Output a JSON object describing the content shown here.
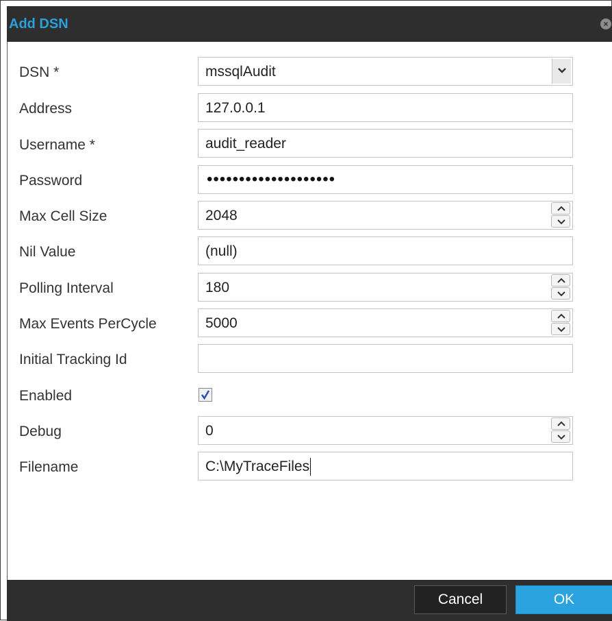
{
  "dialog": {
    "title": "Add DSN",
    "close_icon": "close-icon"
  },
  "fields": {
    "dsn": {
      "label": "DSN *",
      "value": "mssqlAudit"
    },
    "address": {
      "label": "Address",
      "value": "127.0.0.1"
    },
    "username": {
      "label": "Username *",
      "value": "audit_reader"
    },
    "password": {
      "label": "Password",
      "value": "••••••••••••••••••••"
    },
    "max_cell_size": {
      "label": "Max Cell Size",
      "value": "2048"
    },
    "nil_value": {
      "label": "Nil Value",
      "value": "(null)"
    },
    "polling_interval": {
      "label": "Polling Interval",
      "value": "180"
    },
    "max_events_per_cycle": {
      "label": "Max Events PerCycle",
      "value": "5000"
    },
    "initial_tracking_id": {
      "label": "Initial Tracking Id",
      "value": ""
    },
    "enabled": {
      "label": "Enabled",
      "checked": true
    },
    "debug": {
      "label": "Debug",
      "value": "0"
    },
    "filename": {
      "label": "Filename",
      "value": "C:\\MyTraceFiles"
    }
  },
  "buttons": {
    "cancel_label": "Cancel",
    "ok_label": "OK"
  },
  "colors": {
    "accent": "#2aa3e0",
    "titlebar": "#2e2e2e"
  }
}
